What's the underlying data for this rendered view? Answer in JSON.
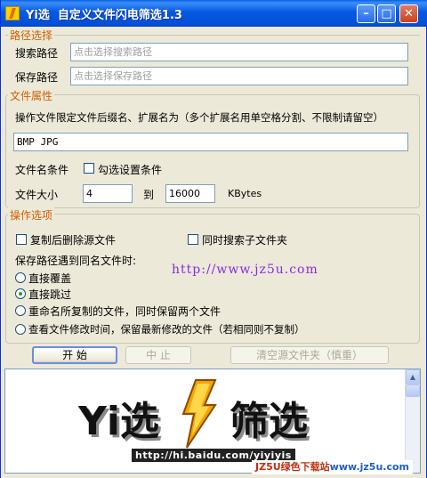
{
  "window": {
    "title": "Yi选  自定义文件闪电筛选1.3",
    "minimize": "–",
    "maximize": "□",
    "close": "✕"
  },
  "path_group": {
    "title": "路径选择",
    "search_label": "搜索路径",
    "search_placeholder": "点击选择搜索路径",
    "save_label": "保存路径",
    "save_placeholder": "点击选择保存路径"
  },
  "attr_group": {
    "title": "文件属性",
    "instruction": "操作文件限定文件后缀名、扩展名为（多个扩展名用单空格分割、不限制请留空）",
    "extensions_value": "BMP JPG",
    "condition_label": "文件名条件",
    "condition_checkbox": "勾选设置条件",
    "size_label": "文件大小",
    "size_min": "4",
    "size_to": "到",
    "size_max": "16000",
    "size_unit": "KBytes"
  },
  "ops_group": {
    "title": "操作选项",
    "delete_source": "复制后删除源文件",
    "search_subfolders": "同时搜索子文件夹",
    "conflict_label": "保存路径遇到同名文件时:",
    "watermark_url": "http://www.jz5u.com",
    "options": [
      {
        "label": "直接覆盖",
        "selected": false
      },
      {
        "label": "直接跳过",
        "selected": true
      },
      {
        "label": "重命名所复制的文件，同时保留两个文件",
        "selected": false
      },
      {
        "label": "查看文件修改时间，保留最新修改的文件（若相同则不复制）",
        "selected": false
      }
    ]
  },
  "buttons": {
    "start": "开  始",
    "stop": "中  止",
    "clear_source": "清空源文件夹（慎重）"
  },
  "banner": {
    "logo_left": "Yi选",
    "logo_right": "筛选",
    "logo_url": "http://hi.baidu.com/yiyiyis",
    "bolt_icon": "lightning-bolt-icon",
    "site_watermark_a": "JZ5U绿色下载站",
    "site_watermark_b": "www.jz5u.com"
  },
  "colors": {
    "titlebar": "#0558e3",
    "group_title": "#d35f00",
    "url_text": "#8a2be2",
    "window_bg": "#ece9d8"
  }
}
